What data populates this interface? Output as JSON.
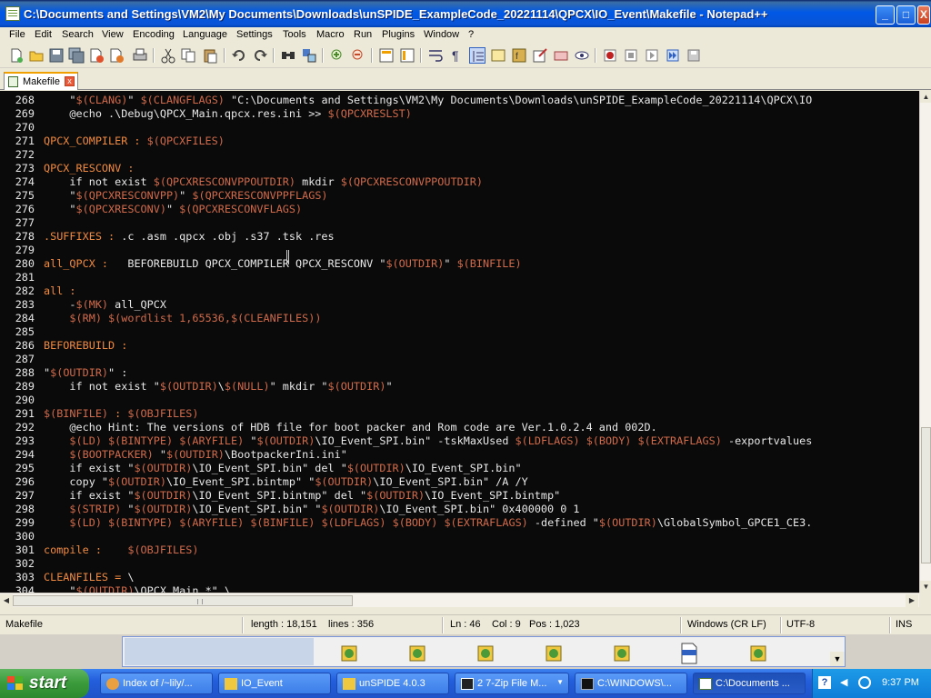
{
  "window": {
    "title": "C:\\Documents and Settings\\VM2\\My Documents\\Downloads\\unSPIDE_ExampleCode_20221114\\QPCX\\IO_Event\\Makefile - Notepad++",
    "minimize": "_",
    "maximize": "□",
    "close": "X"
  },
  "menu": [
    "File",
    "Edit",
    "Search",
    "View",
    "Encoding",
    "Language",
    "Settings",
    "Tools",
    "Macro",
    "Run",
    "Plugins",
    "Window",
    "?"
  ],
  "toolbar_icons": [
    "new-file-icon",
    "open-file-icon",
    "save-icon",
    "save-all-icon",
    "close-icon",
    "close-all-icon",
    "print-icon",
    "cut-icon",
    "copy-icon",
    "paste-icon",
    "undo-icon",
    "redo-icon",
    "find-icon",
    "replace-icon",
    "zoom-in-icon",
    "zoom-out-icon",
    "sync-vertical-icon",
    "sync-horizontal-icon",
    "word-wrap-icon",
    "show-all-chars-icon",
    "indent-guide-icon",
    "doc-map-icon",
    "function-list-icon",
    "folder-workspace-icon",
    "monitoring-icon",
    "eye-icon",
    "record-macro-icon",
    "stop-macro-icon",
    "play-macro-icon",
    "run-macro-multiple-icon",
    "save-macro-icon"
  ],
  "tab": {
    "label": "Makefile",
    "close": "x"
  },
  "editor": {
    "lines": [
      {
        "n": "268",
        "segs": [
          [
            "pl",
            "    \""
          ],
          [
            "var",
            "$(CLANG)"
          ],
          [
            "pl",
            "\" "
          ],
          [
            "var",
            "$(CLANGFLAGS)"
          ],
          [
            "pl",
            " \"C:\\Documents and Settings\\VM2\\My Documents\\Downloads\\unSPIDE_ExampleCode_20221114\\QPCX\\IO"
          ]
        ]
      },
      {
        "n": "269",
        "segs": [
          [
            "pl",
            "    @echo .\\Debug\\QPCX_Main.qpcx.res.ini >> "
          ],
          [
            "var",
            "$(QPCXRESLST)"
          ]
        ]
      },
      {
        "n": "270",
        "segs": []
      },
      {
        "n": "271",
        "segs": [
          [
            "tgt",
            "QPCX_COMPILER : "
          ],
          [
            "var",
            "$(QPCXFILES)"
          ]
        ]
      },
      {
        "n": "272",
        "segs": []
      },
      {
        "n": "273",
        "segs": [
          [
            "tgt",
            "QPCX_RESCONV :"
          ]
        ]
      },
      {
        "n": "274",
        "segs": [
          [
            "pl",
            "    if not exist "
          ],
          [
            "var",
            "$(QPCXRESCONVPPOUTDIR)"
          ],
          [
            "pl",
            " mkdir "
          ],
          [
            "var",
            "$(QPCXRESCONVPPOUTDIR)"
          ]
        ]
      },
      {
        "n": "275",
        "segs": [
          [
            "pl",
            "    \""
          ],
          [
            "var",
            "$(QPCXRESCONVPP)"
          ],
          [
            "pl",
            "\" "
          ],
          [
            "var",
            "$(QPCXRESCONVPPFLAGS)"
          ]
        ]
      },
      {
        "n": "276",
        "segs": [
          [
            "pl",
            "    \""
          ],
          [
            "var",
            "$(QPCXRESCONV)"
          ],
          [
            "pl",
            "\" "
          ],
          [
            "var",
            "$(QPCXRESCONVFLAGS)"
          ]
        ]
      },
      {
        "n": "277",
        "segs": []
      },
      {
        "n": "278",
        "segs": [
          [
            "tgt",
            ".SUFFIXES : "
          ],
          [
            "pl",
            ".c .asm .qpcx .obj .s37 .tsk .res"
          ]
        ]
      },
      {
        "n": "279",
        "segs": []
      },
      {
        "n": "280",
        "segs": [
          [
            "tgt",
            "all_QPCX :"
          ],
          [
            "pl",
            "   BEFOREBUILD QPCX_COMPILER QPCX_RESCONV \""
          ],
          [
            "var",
            "$(OUTDIR)"
          ],
          [
            "pl",
            "\" "
          ],
          [
            "var",
            "$(BINFILE)"
          ]
        ]
      },
      {
        "n": "281",
        "segs": []
      },
      {
        "n": "282",
        "segs": [
          [
            "tgt",
            "all :"
          ]
        ]
      },
      {
        "n": "283",
        "segs": [
          [
            "pl",
            "    -"
          ],
          [
            "var",
            "$(MK)"
          ],
          [
            "pl",
            " all_QPCX"
          ]
        ]
      },
      {
        "n": "284",
        "segs": [
          [
            "pl",
            "    "
          ],
          [
            "var",
            "$(RM)"
          ],
          [
            "pl",
            " "
          ],
          [
            "var",
            "$(wordlist 1,65536,$(CLEANFILES))"
          ]
        ]
      },
      {
        "n": "285",
        "segs": []
      },
      {
        "n": "286",
        "segs": [
          [
            "tgt",
            "BEFOREBUILD :"
          ]
        ]
      },
      {
        "n": "287",
        "segs": []
      },
      {
        "n": "288",
        "segs": [
          [
            "pl",
            "\""
          ],
          [
            "var",
            "$(OUTDIR)"
          ],
          [
            "pl",
            "\" :"
          ]
        ]
      },
      {
        "n": "289",
        "segs": [
          [
            "pl",
            "    if not exist \""
          ],
          [
            "var",
            "$(OUTDIR)"
          ],
          [
            "pl",
            "\\"
          ],
          [
            "var",
            "$(NULL)"
          ],
          [
            "pl",
            "\" mkdir \""
          ],
          [
            "var",
            "$(OUTDIR)"
          ],
          [
            "pl",
            "\""
          ]
        ]
      },
      {
        "n": "290",
        "segs": []
      },
      {
        "n": "291",
        "segs": [
          [
            "var",
            "$(BINFILE)"
          ],
          [
            "tgt",
            " : "
          ],
          [
            "var",
            "$(OBJFILES)"
          ]
        ]
      },
      {
        "n": "292",
        "segs": [
          [
            "pl",
            "    @echo Hint: The versions of HDB file for boot packer and Rom code are Ver.1.0.2.4 and 002D."
          ]
        ]
      },
      {
        "n": "293",
        "segs": [
          [
            "pl",
            "    "
          ],
          [
            "var",
            "$(LD)"
          ],
          [
            "pl",
            " "
          ],
          [
            "var",
            "$(BINTYPE)"
          ],
          [
            "pl",
            " "
          ],
          [
            "var",
            "$(ARYFILE)"
          ],
          [
            "pl",
            " \""
          ],
          [
            "var",
            "$(OUTDIR)"
          ],
          [
            "pl",
            "\\IO_Event_SPI.bin\" -tskMaxUsed "
          ],
          [
            "var",
            "$(LDFLAGS)"
          ],
          [
            "pl",
            " "
          ],
          [
            "var",
            "$(BODY)"
          ],
          [
            "pl",
            " "
          ],
          [
            "var",
            "$(EXTRAFLAGS)"
          ],
          [
            "pl",
            " -exportvalues"
          ]
        ]
      },
      {
        "n": "294",
        "segs": [
          [
            "pl",
            "    "
          ],
          [
            "var",
            "$(BOOTPACKER)"
          ],
          [
            "pl",
            " \""
          ],
          [
            "var",
            "$(OUTDIR)"
          ],
          [
            "pl",
            "\\BootpackerIni.ini\""
          ]
        ]
      },
      {
        "n": "295",
        "segs": [
          [
            "pl",
            "    if exist \""
          ],
          [
            "var",
            "$(OUTDIR)"
          ],
          [
            "pl",
            "\\IO_Event_SPI.bin\" del \""
          ],
          [
            "var",
            "$(OUTDIR)"
          ],
          [
            "pl",
            "\\IO_Event_SPI.bin\""
          ]
        ]
      },
      {
        "n": "296",
        "segs": [
          [
            "pl",
            "    copy \""
          ],
          [
            "var",
            "$(OUTDIR)"
          ],
          [
            "pl",
            "\\IO_Event_SPI.bintmp\" \""
          ],
          [
            "var",
            "$(OUTDIR)"
          ],
          [
            "pl",
            "\\IO_Event_SPI.bin\" /A /Y"
          ]
        ]
      },
      {
        "n": "297",
        "segs": [
          [
            "pl",
            "    if exist \""
          ],
          [
            "var",
            "$(OUTDIR)"
          ],
          [
            "pl",
            "\\IO_Event_SPI.bintmp\" del \""
          ],
          [
            "var",
            "$(OUTDIR)"
          ],
          [
            "pl",
            "\\IO_Event_SPI.bintmp\""
          ]
        ]
      },
      {
        "n": "298",
        "segs": [
          [
            "pl",
            "    "
          ],
          [
            "var",
            "$(STRIP)"
          ],
          [
            "pl",
            " \""
          ],
          [
            "var",
            "$(OUTDIR)"
          ],
          [
            "pl",
            "\\IO_Event_SPI.bin\" \""
          ],
          [
            "var",
            "$(OUTDIR)"
          ],
          [
            "pl",
            "\\IO_Event_SPI.bin\" 0x400000 0 1"
          ]
        ]
      },
      {
        "n": "299",
        "segs": [
          [
            "pl",
            "    "
          ],
          [
            "var",
            "$(LD)"
          ],
          [
            "pl",
            " "
          ],
          [
            "var",
            "$(BINTYPE)"
          ],
          [
            "pl",
            " "
          ],
          [
            "var",
            "$(ARYFILE)"
          ],
          [
            "pl",
            " "
          ],
          [
            "var",
            "$(BINFILE)"
          ],
          [
            "pl",
            " "
          ],
          [
            "var",
            "$(LDFLAGS)"
          ],
          [
            "pl",
            " "
          ],
          [
            "var",
            "$(BODY)"
          ],
          [
            "pl",
            " "
          ],
          [
            "var",
            "$(EXTRAFLAGS)"
          ],
          [
            "pl",
            " -defined \""
          ],
          [
            "var",
            "$(OUTDIR)"
          ],
          [
            "pl",
            "\\GlobalSymbol_GPCE1_CE3."
          ]
        ]
      },
      {
        "n": "300",
        "segs": []
      },
      {
        "n": "301",
        "segs": [
          [
            "tgt",
            "compile :"
          ],
          [
            "pl",
            "    "
          ],
          [
            "var",
            "$(OBJFILES)"
          ]
        ]
      },
      {
        "n": "302",
        "segs": []
      },
      {
        "n": "303",
        "segs": [
          [
            "tgt",
            "CLEANFILES = "
          ],
          [
            "pl",
            "\\"
          ]
        ]
      },
      {
        "n": "304",
        "segs": [
          [
            "pl",
            "    \""
          ],
          [
            "var",
            "$(OUTDIR)"
          ],
          [
            "pl",
            "\\QPCX_Main.*\" \\"
          ]
        ]
      }
    ]
  },
  "status": {
    "file_type": "Makefile",
    "length": "length : 18,151",
    "lines": "lines : 356",
    "ln": "Ln : 46",
    "col": "Col : 9",
    "pos": "Pos : 1,023",
    "eol": "Windows (CR LF)",
    "encoding": "UTF-8",
    "mode": "INS"
  },
  "taskbar": {
    "start": "start",
    "tasks": [
      {
        "label": "Index of /~lily/...",
        "active": false
      },
      {
        "label": "IO_Event",
        "active": false
      },
      {
        "label": "unSPIDE 4.0.3",
        "active": false
      },
      {
        "label": "2  7-Zip File M...",
        "active": false
      },
      {
        "label": "C:\\WINDOWS\\...",
        "active": false
      },
      {
        "label": "C:\\Documents ...",
        "active": true
      }
    ],
    "clock": "9:37 PM"
  },
  "colors": {
    "editor_bg": "#0A0A0A",
    "target": "#F08A40",
    "variable": "#D06A4A",
    "text": "#E8E8E8",
    "titlebar": "#0058E6"
  }
}
